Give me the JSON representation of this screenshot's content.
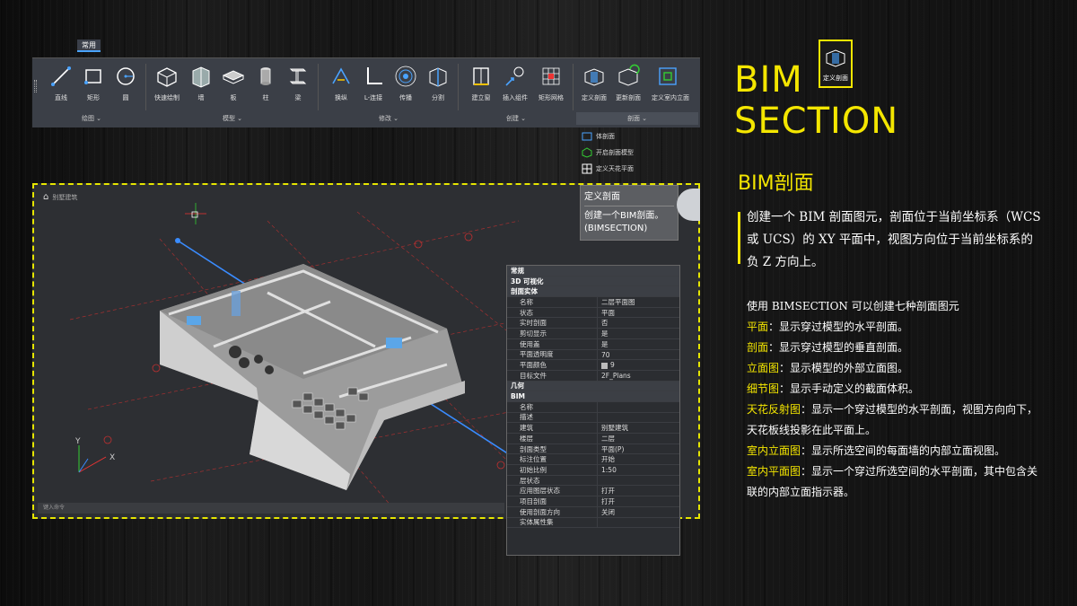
{
  "ribbon": {
    "tab": "常用",
    "tools": [
      {
        "label": "直线",
        "icon": "line-icon"
      },
      {
        "label": "矩形",
        "icon": "rectangle-icon"
      },
      {
        "label": "圆",
        "icon": "circle-icon"
      },
      {
        "label": "快速绘制",
        "icon": "quick-draw-icon"
      },
      {
        "label": "墙",
        "icon": "wall-icon"
      },
      {
        "label": "板",
        "icon": "slab-icon"
      },
      {
        "label": "柱",
        "icon": "column-icon"
      },
      {
        "label": "梁",
        "icon": "beam-icon"
      },
      {
        "label": "换纵",
        "icon": "switch-icon"
      },
      {
        "label": "L-连接",
        "icon": "l-join-icon"
      },
      {
        "label": "传播",
        "icon": "propagate-icon"
      },
      {
        "label": "分割",
        "icon": "split-icon"
      },
      {
        "label": "建立窗",
        "icon": "window-icon"
      },
      {
        "label": "插入组件",
        "icon": "insert-component-icon"
      },
      {
        "label": "矩形网格",
        "icon": "rect-grid-icon"
      },
      {
        "label": "定义剖面",
        "icon": "define-section-icon"
      },
      {
        "label": "更新剖面",
        "icon": "update-section-icon"
      },
      {
        "label": "定义室内立面",
        "icon": "interior-elevation-icon"
      }
    ],
    "groups": [
      {
        "label": "绘图 ⌄"
      },
      {
        "label": "模型 ⌄"
      },
      {
        "label": "修改 ⌄"
      },
      {
        "label": "创建 ⌄"
      },
      {
        "label": "剖面 ⌄"
      }
    ],
    "dropdown": [
      "体剖面",
      "开启剖面模型",
      "定义天花平面"
    ]
  },
  "viewport": {
    "title": "别墅建筑",
    "command_placeholder": "键入命令",
    "tooltip_title": "定义剖面",
    "tooltip_desc": "创建一个BIM剖面。(BIMSECTION)"
  },
  "properties": [
    {
      "head": "常规"
    },
    {
      "head": "3D 可视化"
    },
    {
      "head": "剖面实体"
    },
    {
      "k": "名称",
      "v": "二层平面图"
    },
    {
      "k": "状态",
      "v": "平面"
    },
    {
      "k": "实时剖面",
      "v": "否"
    },
    {
      "k": "剪切显示",
      "v": "是"
    },
    {
      "k": "使用盖",
      "v": "是"
    },
    {
      "k": "平面透明度",
      "v": "70"
    },
    {
      "k": "平面颜色",
      "v": "9",
      "swatch": true
    },
    {
      "k": "目标文件",
      "v": "2F_Plans"
    },
    {
      "head": "几何"
    },
    {
      "head": "BIM"
    },
    {
      "k": "名称",
      "v": ""
    },
    {
      "k": "描述",
      "v": ""
    },
    {
      "k": "建筑",
      "v": "别墅建筑"
    },
    {
      "k": "楼层",
      "v": "二层"
    },
    {
      "k": "剖面类型",
      "v": "平面(P)"
    },
    {
      "k": "标注位置",
      "v": "开始"
    },
    {
      "k": "初始比例",
      "v": "1:50"
    },
    {
      "k": "层状态",
      "v": ""
    },
    {
      "k": "应用图层状态",
      "v": "打开"
    },
    {
      "k": "项目剖面",
      "v": "打开"
    },
    {
      "k": "使用剖面方向",
      "v": "关闭"
    },
    {
      "k": "实体属性集",
      "v": ""
    }
  ],
  "right": {
    "title_line1": "BIM",
    "title_line2": "SECTION",
    "badge_label": "定义剖面",
    "subtitle": "BIM剖面",
    "description": "创建一个 BIM 剖面图元，剖面位于当前坐标系（WCS 或 UCS）的 XY 平面中，视图方向位于当前坐标系的负 Z 方向上。",
    "intro": "使用 BIMSECTION 可以创建七种剖面图元",
    "items": [
      {
        "term": "平面",
        "text": "：显示穿过模型的水平剖面。"
      },
      {
        "term": "剖面",
        "text": "：显示穿过模型的垂直剖面。"
      },
      {
        "term": "立面图",
        "text": "：显示模型的外部立面图。"
      },
      {
        "term": "细节图",
        "text": "：显示手动定义的截面体积。"
      },
      {
        "term": "天花反射图",
        "text": "：显示一个穿过模型的水平剖面，视图方向向下，天花板线投影在此平面上。"
      },
      {
        "term": "室内立面图",
        "text": "：显示所选空间的每面墙的内部立面视图。"
      },
      {
        "term": "室内平面图",
        "text": "：显示一个穿过所选空间的水平剖面，其中包含关联的内部立面指示器。"
      }
    ]
  },
  "colors": {
    "accent": "#f4e600",
    "ribbon": "#3b3f47",
    "viewport": "#2d2f33"
  }
}
